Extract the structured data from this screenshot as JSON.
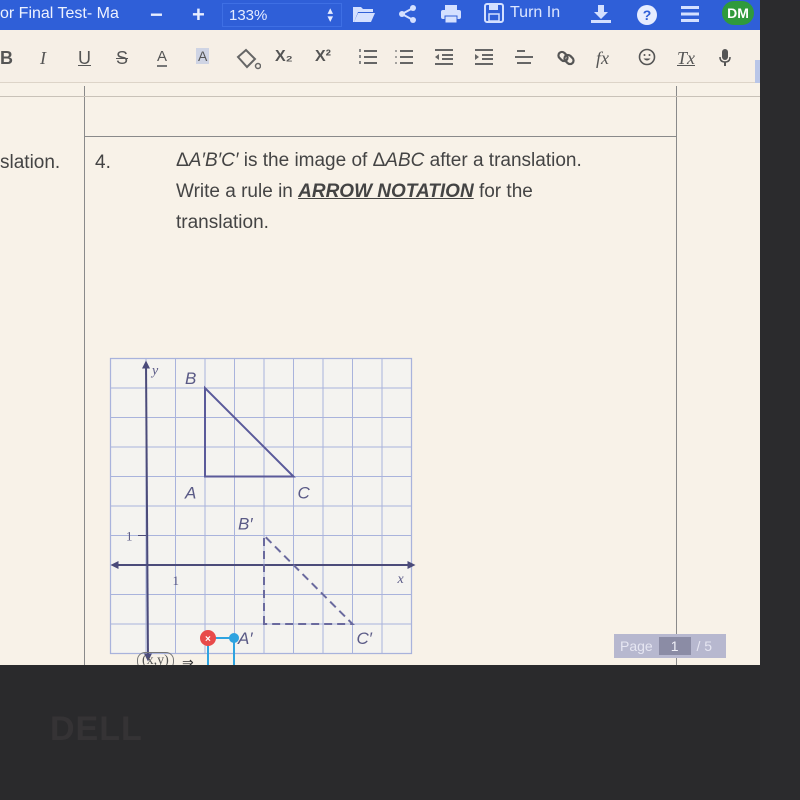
{
  "app": {
    "doc_title": "or Final Test- Ma",
    "zoom_out_label": "−",
    "zoom_in_label": "+",
    "zoom_level": "133%",
    "turn_in_label": "Turn In",
    "user_initials": "DM",
    "colors": {
      "topbar": "#2f5fd8",
      "avatar": "#2f9a3c"
    }
  },
  "toolbar": {
    "icons": [
      "folder-open-icon",
      "share-icon",
      "print-icon",
      "save-icon",
      "download-icon",
      "help-icon",
      "menu-icon"
    ],
    "format": {
      "bold": "B",
      "italic": "I",
      "underline": "U",
      "strike": "S",
      "font_color": "A",
      "highlight": "A",
      "subscript": "X₂",
      "superscript": "X²",
      "formula": "fx",
      "clear_format": "Tx"
    }
  },
  "document": {
    "prev_cell_text": "slation.",
    "question_number": "4.",
    "question_line1_prefix": "Δ",
    "question_line1_image": "A′B′C′",
    "question_line1_mid": " is the image of ",
    "question_line1_delta": "Δ",
    "question_line1_orig": "ABC",
    "question_line1_suffix": " after a translation.",
    "question_line2_prefix": "Write a rule in ",
    "question_line2_emph": "ARROW NOTATION",
    "question_line2_suffix": " for the",
    "question_line3": "translation.",
    "answer_prefix": "(x,y)"
  },
  "figure": {
    "axis_labels": {
      "x": "x",
      "y": "y",
      "x_tick": "1",
      "y_tick": "1"
    },
    "original": {
      "A": [
        2,
        3
      ],
      "B": [
        2,
        6
      ],
      "C": [
        5,
        3
      ]
    },
    "image": {
      "A'": [
        4,
        -2
      ],
      "B'": [
        4,
        1
      ],
      "C'": [
        7,
        -2
      ]
    },
    "labels": {
      "A": "A",
      "B": "B",
      "C": "C",
      "A'": "A′",
      "B'": "B′",
      "C'": "C′"
    },
    "grid_x_range": [
      -1,
      9
    ],
    "grid_y_range": [
      -3,
      7
    ]
  },
  "pager": {
    "label": "Page",
    "current": "1",
    "total": "/ 5"
  },
  "bezel": {
    "brand": "DELL"
  }
}
